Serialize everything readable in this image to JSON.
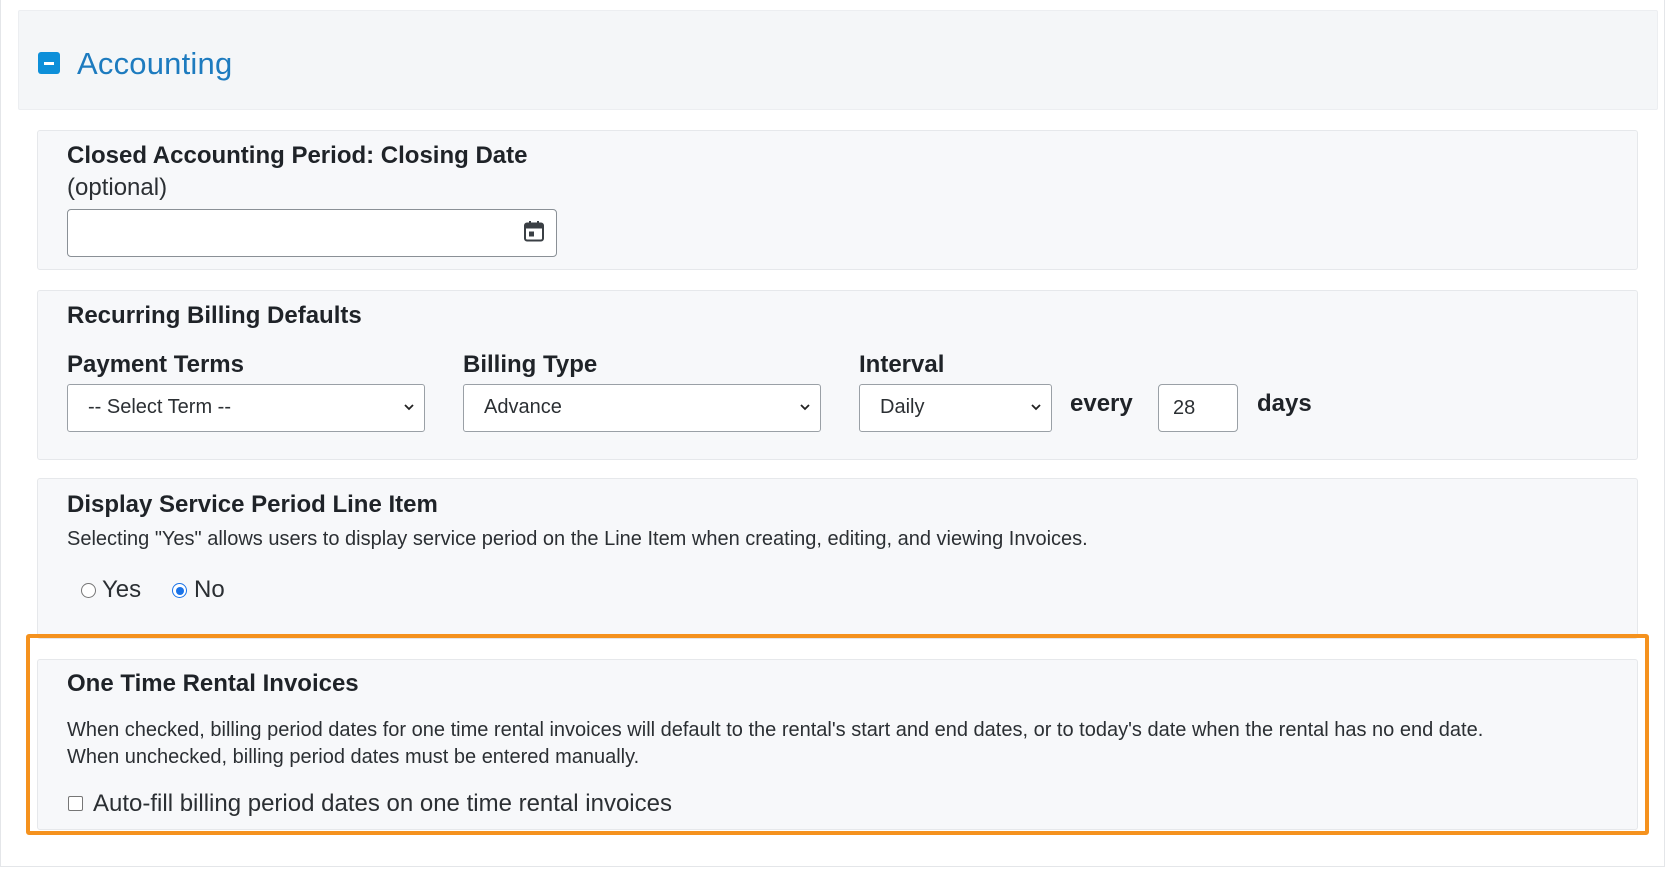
{
  "section": {
    "title": "Accounting",
    "collapse_icon": "minus-square-icon",
    "accent_color": "#1d7bbf"
  },
  "closing_date": {
    "label": "Closed Accounting Period: Closing Date",
    "sublabel": "(optional)",
    "value": "",
    "icon": "calendar-icon"
  },
  "recurring": {
    "title": "Recurring Billing Defaults",
    "payment_terms": {
      "label": "Payment Terms",
      "value": "-- Select Term --"
    },
    "billing_type": {
      "label": "Billing Type",
      "value": "Advance"
    },
    "interval": {
      "label": "Interval",
      "value": "Daily",
      "every_label": "every",
      "count": "28",
      "days_label": "days"
    }
  },
  "service_period": {
    "title": "Display Service Period Line Item",
    "description": "Selecting \"Yes\" allows users to display service period on the Line Item when creating, editing, and viewing Invoices.",
    "options": [
      {
        "label": "Yes",
        "checked": false
      },
      {
        "label": "No",
        "checked": true
      }
    ]
  },
  "one_time_rental": {
    "title": "One Time Rental Invoices",
    "description_line1": "When checked, billing period dates for one time rental invoices will default to the rental's start and end dates, or to today's date when the rental has no end date.",
    "description_line2": "When unchecked, billing period dates must be entered manually.",
    "checkbox_label": "Auto-fill billing period dates on one time rental invoices",
    "checked": false,
    "highlight_color": "#f5921e"
  }
}
